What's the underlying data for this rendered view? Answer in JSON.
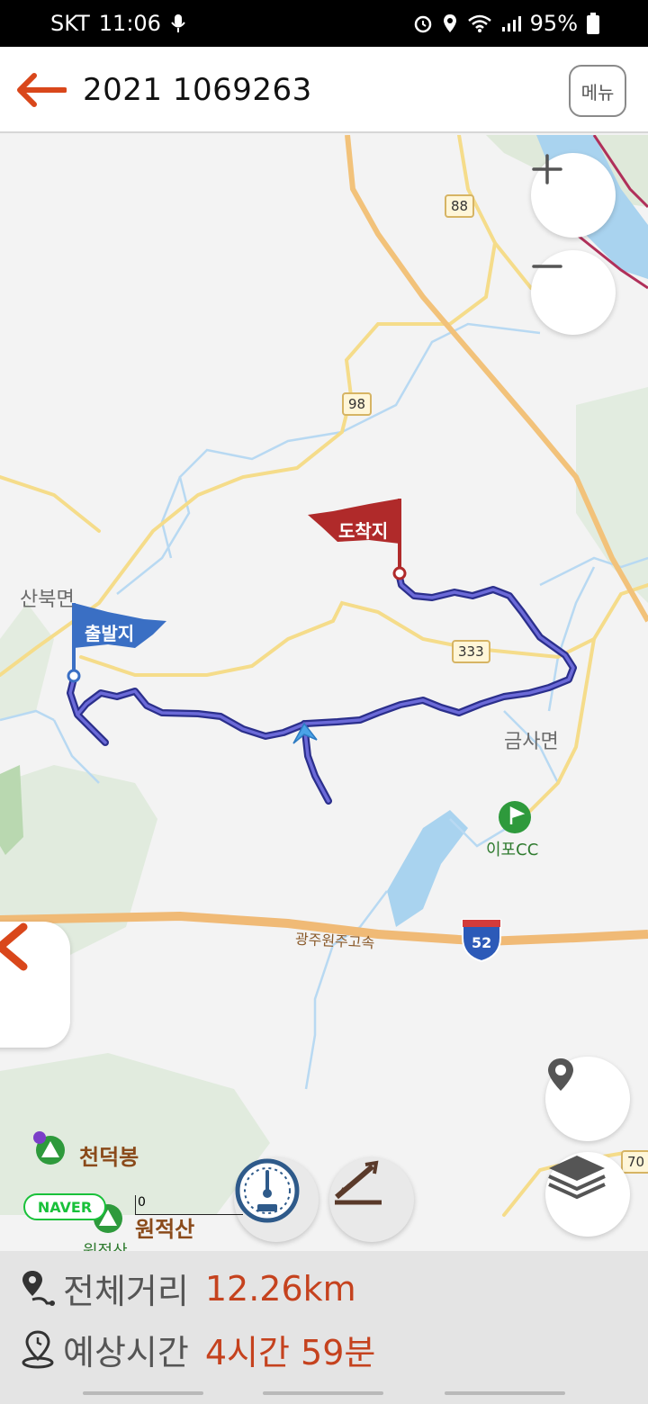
{
  "status_bar": {
    "carrier": "SKT",
    "time": "11:06",
    "battery": "95%"
  },
  "header": {
    "title": "2021 1069263",
    "menu_label": "메뉴"
  },
  "map": {
    "labels": {
      "sanbuk": "산북면",
      "geumsa": "금사면",
      "golf": "이포CC",
      "highway": "광주원주고속",
      "peak_cheondeok": "천덕봉",
      "peak_wonjeok": "원적산",
      "peak_wonjeok_sub": "원적산"
    },
    "road_numbers": {
      "r88": "88",
      "r98": "98",
      "r333": "333",
      "r70": "70",
      "r52": "52"
    },
    "flags": {
      "start": "출발지",
      "end": "도착지"
    },
    "naver": "NAVER",
    "scale": "0"
  },
  "info": {
    "distance_label": "전체거리",
    "distance_value": "12.26km",
    "time_label": "예상시간",
    "time_value": "4시간 59분"
  },
  "colors": {
    "accent": "#c5421e",
    "route": "#3c3cb4",
    "start_flag": "#3a6fc4",
    "end_flag": "#b02a2a"
  }
}
